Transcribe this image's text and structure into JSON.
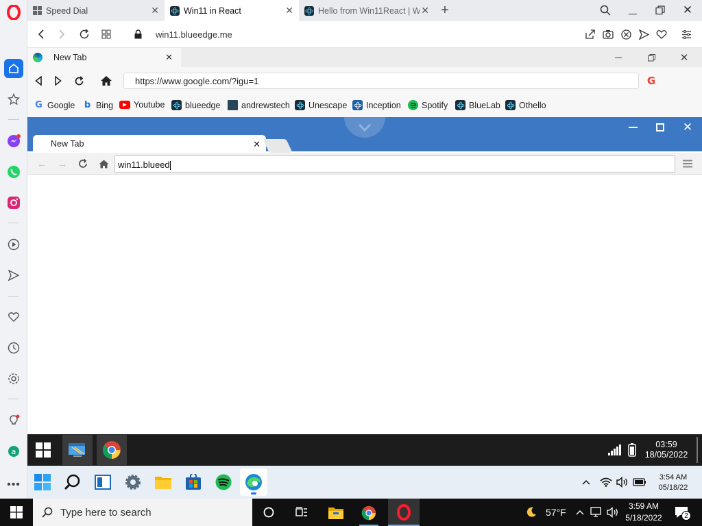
{
  "opera": {
    "tabs": [
      {
        "label": "Speed Dial"
      },
      {
        "label": "Win11 in React"
      },
      {
        "label": "Hello from Win11React | W"
      }
    ],
    "address": "win11.blueedge.me"
  },
  "edge": {
    "tab_label": "New Tab",
    "url": "https://www.google.com/?igu=1",
    "bookmarks": [
      {
        "label": "Google"
      },
      {
        "label": "Bing"
      },
      {
        "label": "Youtube"
      },
      {
        "label": "blueedge"
      },
      {
        "label": "andrewstech"
      },
      {
        "label": "Unescape"
      },
      {
        "label": "Inception"
      },
      {
        "label": "Spotify"
      },
      {
        "label": "BlueLab"
      },
      {
        "label": "Othello"
      }
    ]
  },
  "chrome": {
    "tab_label": "New Tab",
    "omnibox_value": "win11.blueed"
  },
  "inner_taskbar": {
    "time": "03:59",
    "date": "18/05/2022"
  },
  "w11_taskbar": {
    "time": "3:54 AM",
    "date": "05/18/22"
  },
  "w10_taskbar": {
    "search_placeholder": "Type here to search",
    "weather": "57°F",
    "time": "3:59 AM",
    "date": "5/18/2022",
    "notifications": "2"
  },
  "colors": {
    "opera_red": "#ff1b2d",
    "chrome_blue": "#3c78c3",
    "taskbar_dark": "#101010"
  }
}
